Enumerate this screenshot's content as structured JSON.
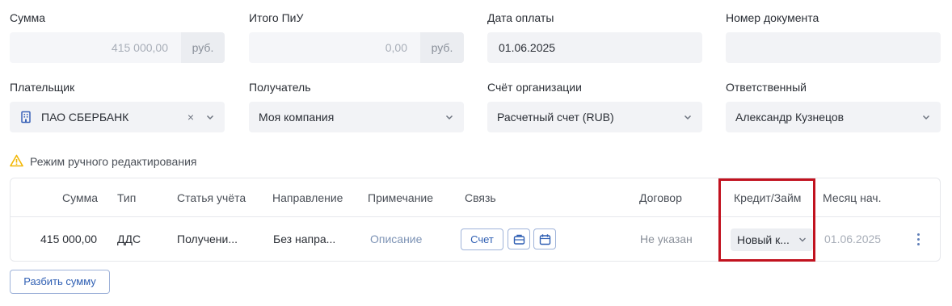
{
  "form": {
    "amount": {
      "label": "Сумма",
      "value": "415 000,00",
      "unit": "руб."
    },
    "total_piu": {
      "label": "Итого ПиУ",
      "value": "0,00",
      "unit": "руб."
    },
    "payment_date": {
      "label": "Дата оплаты",
      "value": "01.06.2025"
    },
    "document_number": {
      "label": "Номер документа",
      "value": ""
    },
    "payer": {
      "label": "Плательщик",
      "value": "ПАО СБЕРБАНК",
      "clear": "×",
      "icon": "building-icon"
    },
    "recipient": {
      "label": "Получатель",
      "value": "Моя компания"
    },
    "org_account": {
      "label": "Счёт организации",
      "value": "Расчетный счет (RUB)"
    },
    "responsible": {
      "label": "Ответственный",
      "value": "Александр Кузнецов"
    }
  },
  "manual_mode": {
    "text": "Режим ручного редактирования",
    "icon": "warning-icon"
  },
  "table": {
    "headers": {
      "amount": "Сумма",
      "type": "Тип",
      "article": "Статья учёта",
      "direction": "Направление",
      "note": "Примечание",
      "link": "Связь",
      "contract": "Договор",
      "credit": "Кредит/Займ",
      "month": "Месяц нач."
    },
    "rows": [
      {
        "amount": "415 000,00",
        "type": "ДДС",
        "article": "Получени...",
        "direction": "Без напра...",
        "note": "Описание",
        "link_button": "Счет",
        "contract": "Не указан",
        "credit": "Новый к...",
        "month": "01.06.2025"
      }
    ]
  },
  "split_button": "Разбить сумму",
  "colors": {
    "accent": "#2f5fb3",
    "highlight": "#c1121f",
    "warning": "#f2b705"
  }
}
